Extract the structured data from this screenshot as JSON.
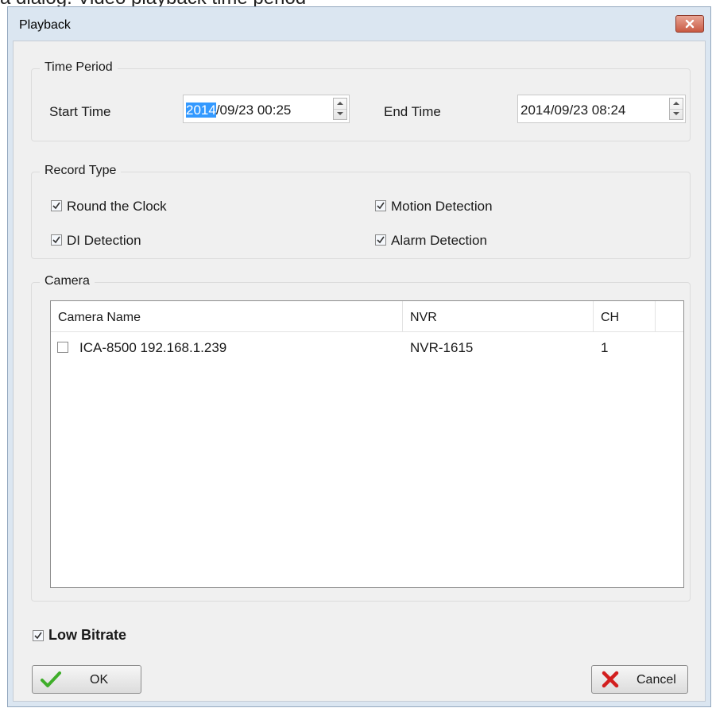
{
  "caption": "a dialog. Video playback time period",
  "window": {
    "title": "Playback"
  },
  "time_period": {
    "label": "Time Period",
    "start_label": "Start Time",
    "start_value_selected": "2014",
    "start_value_rest": "/09/23 00:25",
    "end_label": "End Time",
    "end_value": "2014/09/23 08:24"
  },
  "record_type": {
    "label": "Record Type",
    "options": [
      {
        "label": "Round the Clock",
        "checked": true
      },
      {
        "label": "Motion Detection",
        "checked": true
      },
      {
        "label": "DI Detection",
        "checked": true
      },
      {
        "label": "Alarm Detection",
        "checked": true
      }
    ]
  },
  "camera": {
    "label": "Camera",
    "columns": [
      "Camera Name",
      "NVR",
      "CH"
    ],
    "rows": [
      {
        "name": "ICA-8500 192.168.1.239",
        "nvr": "NVR-1615",
        "ch": "1",
        "checked": false
      }
    ]
  },
  "low_bitrate": {
    "label": "Low Bitrate",
    "checked": true
  },
  "buttons": {
    "ok": "OK",
    "cancel": "Cancel"
  },
  "icons": {
    "ok": "green-checkmark-icon",
    "cancel": "red-x-icon",
    "close": "close-icon"
  },
  "colors": {
    "titlebar": "#dbe6f1",
    "selection": "#3399ff",
    "close_button": "#c95a43",
    "ok_check": "#3fae2a",
    "cancel_x": "#d21f1f"
  }
}
